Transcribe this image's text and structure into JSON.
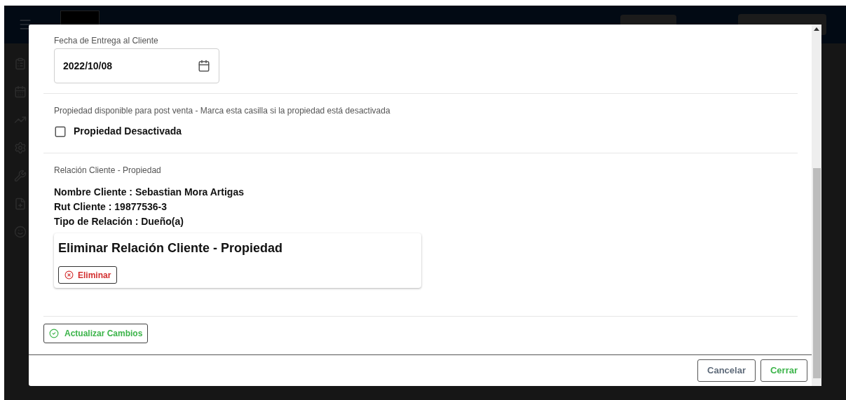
{
  "modal": {
    "delivery_date": {
      "label": "Fecha de Entrega al Cliente",
      "value": "2022/10/08"
    },
    "availability": {
      "label": "Propiedad disponible para post venta - Marca esta casilla si la propiedad está desactivada",
      "checkbox": {
        "label": "Propiedad Desactivada",
        "checked": false
      }
    },
    "relation": {
      "label": "Relación Cliente - Propiedad",
      "details": [
        "Nombre Cliente : Sebastian Mora Artigas",
        "Rut Cliente : 19877536-3",
        "Tipo de Relación : Dueño(a)"
      ],
      "delete_card": {
        "title": "Eliminar Relación Cliente - Propiedad",
        "button": "Eliminar"
      }
    },
    "update_button": "Actualizar Cambios",
    "footer_buttons": [
      {
        "label": "Cancelar",
        "kind": "neutral"
      },
      {
        "label": "Cerrar",
        "kind": "primary"
      }
    ]
  }
}
